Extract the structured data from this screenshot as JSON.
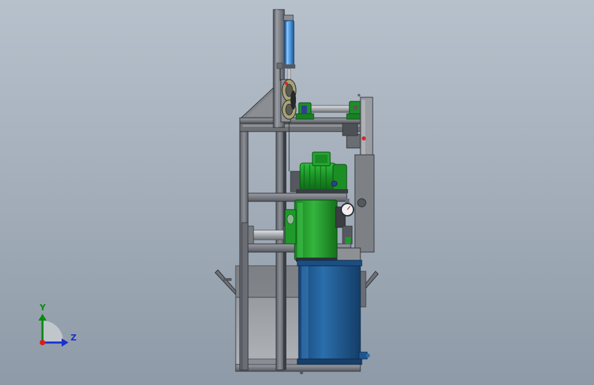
{
  "viewport": {
    "background_top": "#b7c1cc",
    "background_bottom": "#8e9aa7"
  },
  "colors": {
    "frame_steel": "#7d8187",
    "frame_dark": "#4b4f55",
    "motor_green": "#1f9a2a",
    "pump_green": "#23a332",
    "tank_blue": "#1f5f97",
    "cylinder_blue": "#3d8fd6",
    "accent_red": "#d22a2a"
  },
  "triad": {
    "y_label": "Y",
    "z_label": "Z",
    "y_color": "#0a8a10",
    "z_color": "#1a2fcf",
    "origin_color": "#d62020"
  },
  "parts": [
    "hydraulic-cylinder",
    "pulley-assembly",
    "shaft-with-bearings",
    "top-frame-plate",
    "electric-motor",
    "mid-frame-bar",
    "hydraulic-pump",
    "pressure-gauge",
    "oil-tank",
    "base-frame"
  ]
}
